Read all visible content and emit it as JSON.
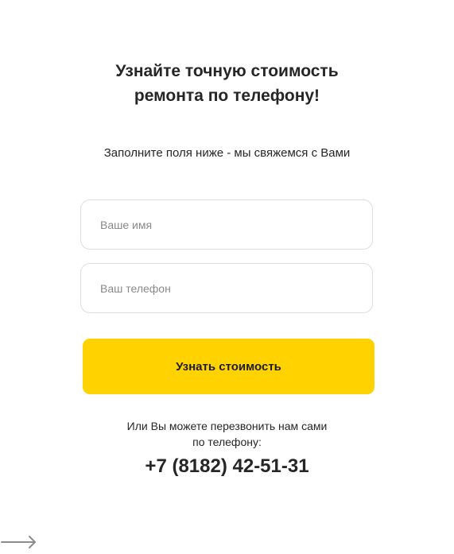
{
  "form": {
    "title_line1": "Узнайте точную стоимость",
    "title_line2": "ремонта по телефону!",
    "subtitle": "Заполните поля ниже - мы свяжемся с Вами",
    "name_input": {
      "value": "",
      "placeholder": "Ваше имя"
    },
    "phone_input": {
      "value": "",
      "placeholder": "Ваш телефон"
    },
    "submit_label": "Узнать стоимость",
    "accent_color": "#ffd200"
  },
  "callback": {
    "note_line1": "Или Вы можете перезвонить нам сами",
    "note_line2": "по телефону:",
    "phone": "+7 (8182) 42-51-31"
  },
  "icons": {
    "bottom_left": "arrow-right-icon"
  }
}
